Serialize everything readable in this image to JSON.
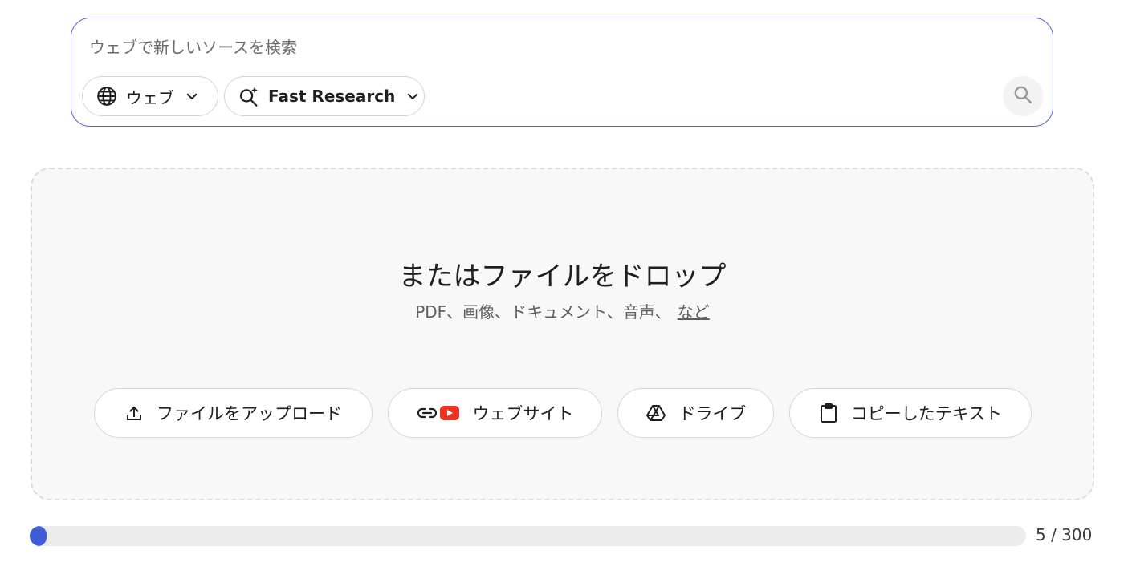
{
  "search": {
    "placeholder": "ウェブで新しいソースを検索",
    "value": "",
    "source_chip": {
      "label": "ウェブ",
      "icon": "globe-icon"
    },
    "research_chip": {
      "label": "Fast Research",
      "icon": "search-sparkle-icon"
    },
    "submit_icon": "search-icon"
  },
  "drop_zone": {
    "title": "またはファイルをドロップ",
    "subtitle": "PDF、画像、ドキュメント、音声、",
    "more_link": "など",
    "actions": [
      {
        "label": "ファイルをアップロード",
        "icon": "upload-icon"
      },
      {
        "label": "ウェブサイト",
        "icon": "link-youtube-icon"
      },
      {
        "label": "ドライブ",
        "icon": "drive-icon"
      },
      {
        "label": "コピーしたテキスト",
        "icon": "clipboard-icon"
      }
    ]
  },
  "sources": {
    "count_text": "5 / 300",
    "used": 5,
    "limit": 300
  },
  "colors": {
    "accent": "#3f5bd6",
    "search_border": "#5b5fd4",
    "youtube_red": "#ea3323"
  }
}
